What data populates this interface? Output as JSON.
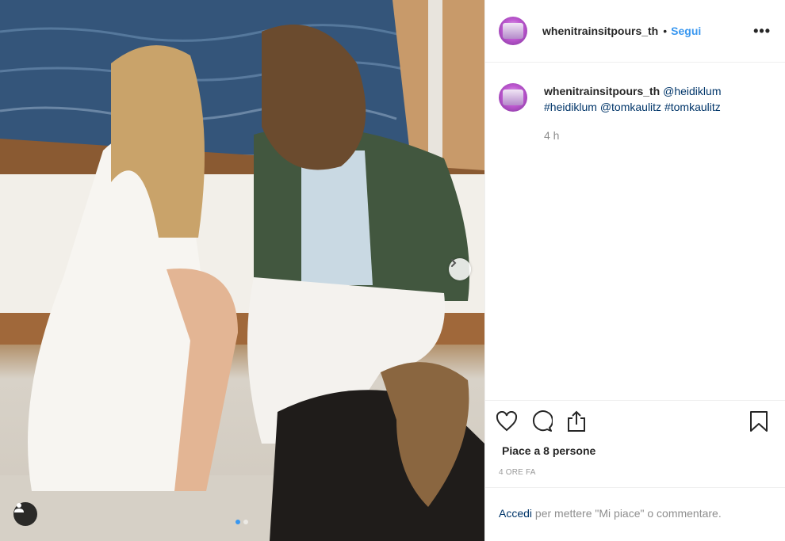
{
  "post": {
    "author": "whenitrainsitpours_th",
    "separator": "•",
    "follow_label": "Segui",
    "more_label": "•••",
    "caption": {
      "username": "whenitrainsitpours_th",
      "mention1": "@heidiklum",
      "hashtag1": "#heidiklum",
      "mention2": "@tomkaulitz",
      "hashtag2": "#tomkaulitz"
    },
    "time_relative": "4 h",
    "likes_text": "Piace a 8 persone",
    "time_full": "4 ORE FA",
    "login_link": "Accedi",
    "login_text": " per mettere \"Mi piace\" o commentare."
  },
  "carousel": {
    "current": 1,
    "total": 2
  },
  "icons": {
    "like": "heart-icon",
    "comment": "comment-icon",
    "share": "share-icon",
    "save": "bookmark-icon",
    "next": "chevron-right-icon",
    "tag": "user-icon"
  },
  "colors": {
    "accent": "#3897f0",
    "link": "#003569",
    "muted": "#8e8e8e"
  }
}
